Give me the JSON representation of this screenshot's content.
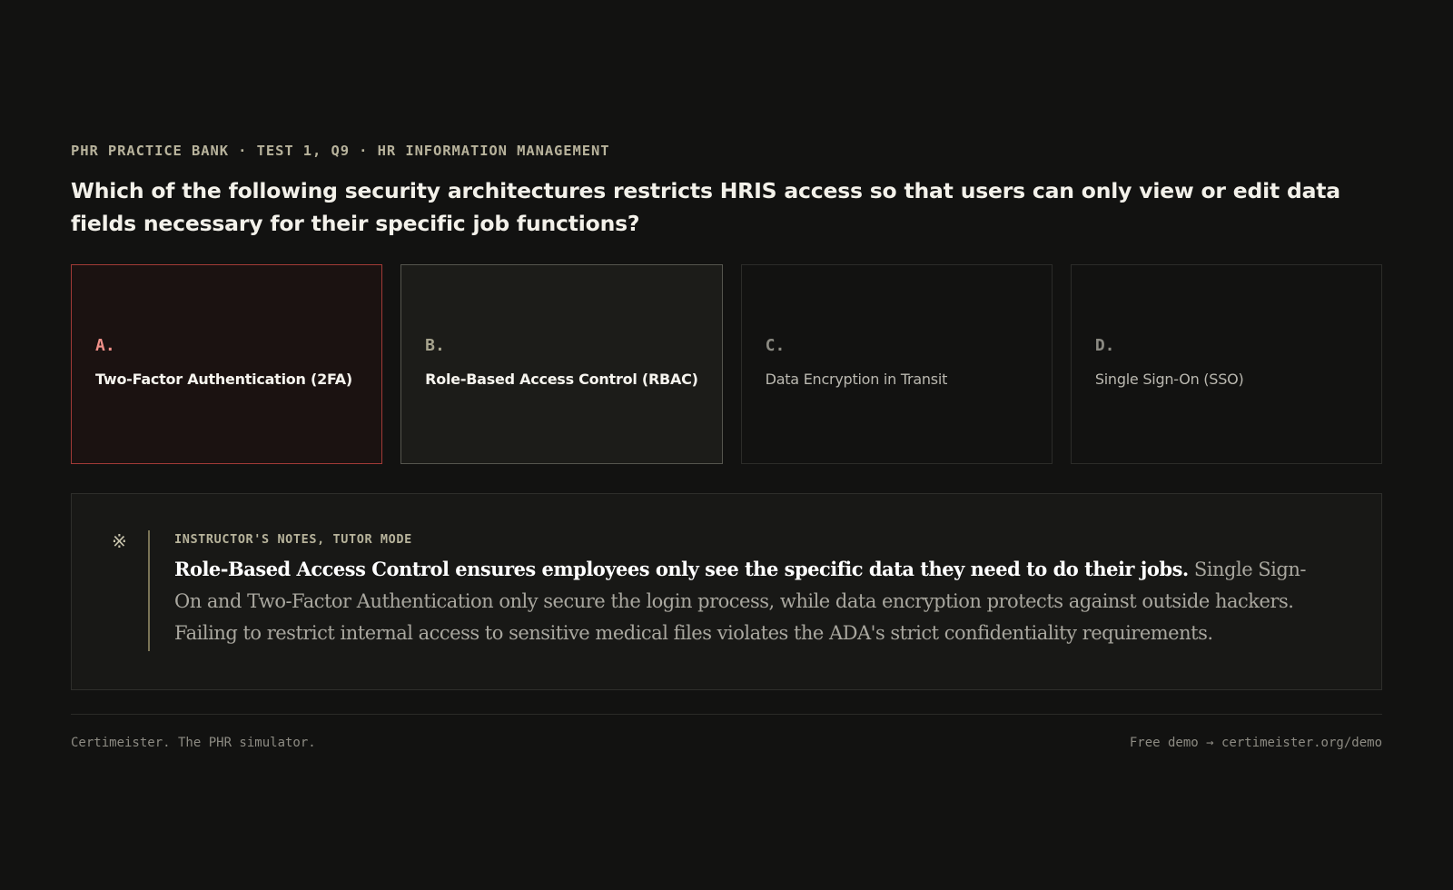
{
  "header": {
    "eyebrow": "PHR PRACTICE BANK · TEST 1, Q9 · HR INFORMATION MANAGEMENT",
    "question": "Which of the following security architectures restricts HRIS access so that users can only view or edit data fields necessary for their specific job functions?"
  },
  "options": [
    {
      "letter": "A.",
      "text": "Two-Factor Authentication (2FA)",
      "state": "selected-incorrect"
    },
    {
      "letter": "B.",
      "text": "Role-Based Access Control (RBAC)",
      "state": "correct"
    },
    {
      "letter": "C.",
      "text": "Data Encryption in Transit",
      "state": "default"
    },
    {
      "letter": "D.",
      "text": "Single Sign-On (SSO)",
      "state": "default"
    }
  ],
  "notes": {
    "label": "INSTRUCTOR'S NOTES, TUTOR MODE",
    "lead": "Role-Based Access Control ensures employees only see the specific data they need to do their jobs.",
    "body": " Single Sign-On and Two-Factor Authentication only secure the login process, while data encryption protects against outside hackers. Failing to restrict internal access to sensitive medical files violates the ADA's strict confidentiality requirements."
  },
  "footer": {
    "left": "Certimeister. The PHR simulator.",
    "right": "Free demo → certimeister.org/demo"
  },
  "colors": {
    "background": "#121211",
    "incorrect_accent": "#a13a36",
    "incorrect_letter": "#f09089",
    "note_rule": "#7a7456"
  }
}
